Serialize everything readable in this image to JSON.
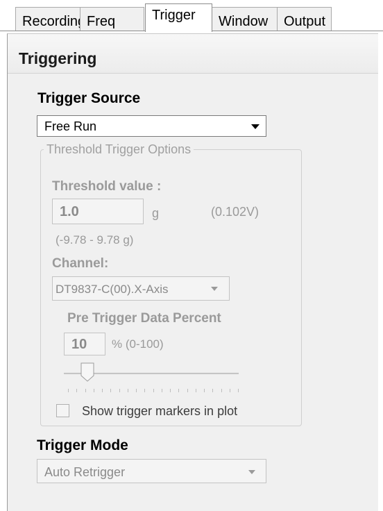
{
  "tabs": [
    {
      "label": "Recording",
      "active": false
    },
    {
      "label": "Freq",
      "active": false
    },
    {
      "label": "Trigger",
      "active": true
    },
    {
      "label": "Window",
      "active": false
    },
    {
      "label": "Output",
      "active": false
    }
  ],
  "panel": {
    "title": "Triggering"
  },
  "trigger_source": {
    "label": "Trigger Source",
    "selected": "Free Run",
    "enabled": true
  },
  "threshold_options": {
    "group_title": "Threshold Trigger Options",
    "enabled": false,
    "threshold_label": "Threshold value :",
    "threshold_value": "1.0",
    "threshold_unit": "g",
    "threshold_voltage": "(0.102V)",
    "threshold_range": "(-9.78 - 9.78 g)",
    "channel_label": "Channel:",
    "channel_selected": "DT9837-C(00).X-Axis",
    "pre_trigger_label": "Pre Trigger Data Percent",
    "pre_trigger_value": "10",
    "pre_trigger_range": "% (0-100)",
    "pre_trigger_slider_fraction": 0.1,
    "show_markers_label": "Show trigger markers in plot",
    "show_markers_checked": false
  },
  "trigger_mode": {
    "label": "Trigger Mode",
    "selected": "Auto Retrigger",
    "enabled": false
  },
  "colors": {
    "panel_background": "#f0f0f0",
    "disabled_text": "#9a9a9a",
    "active_tab": "#ffffff"
  }
}
